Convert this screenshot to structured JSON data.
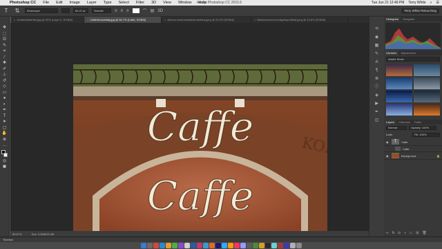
{
  "menubar": {
    "app_name": "Photoshop CC",
    "items": [
      "File",
      "Edit",
      "Image",
      "Layer",
      "Type",
      "Select",
      "Filter",
      "3D",
      "View",
      "Window",
      "Help"
    ],
    "window_title": "Adobe Photoshop CC 2015.5",
    "clock": "Tue Jun 21  12:49 PM",
    "user": "Terry White"
  },
  "options": {
    "font_family": "Kinescope",
    "font_size": "84.47 pt",
    "antialias": "Smooth",
    "workspace": "Terry White Retouching"
  },
  "tabs": [
    {
      "label": "GoldenWaterfall.jpg @ 50% (Layer 0, RGB/8)",
      "active": false
    },
    {
      "label": "CaffeVeronaItaly.jpg @ 66.7% (Caffe, RGB/8)",
      "active": true
    },
    {
      "label": "African-Americanblackmanfara.jpeg @ 23.4% (RGB/8)",
      "active": false
    },
    {
      "label": "Blackhairservicefullgolfsportfield.jpeg @ 43.8% (RGB/8)",
      "active": false
    }
  ],
  "canvas": {
    "sign_top": "Caffe",
    "sign_bottom": "Caffe",
    "wall_text_right": "KONG"
  },
  "status": {
    "zoom": "66.67%",
    "doc": "Doc: 3.30M/15.2M"
  },
  "timeline_label": "Timeline",
  "panels": {
    "histogram_tabs": [
      "Histogram",
      "Navigator"
    ],
    "library_tabs": [
      "Libraries",
      "Adjustments"
    ],
    "library_source": "Adobe Stock",
    "layers_tabs": [
      "Layers",
      "Channels",
      "Paths"
    ],
    "blend_mode": "Normal",
    "opacity": "Opacity: 100%",
    "fill": "Fill: 100%",
    "lock": "Lock:",
    "layers": [
      {
        "name": "Caffe",
        "type": "text",
        "selected": false
      },
      {
        "name": "Caffe",
        "type": "smart",
        "selected": false
      },
      {
        "name": "Background",
        "type": "image",
        "selected": false
      }
    ]
  },
  "colors": {
    "wall": "#7a3e22",
    "arch": "#a85838",
    "sign": "#f2ead5"
  }
}
